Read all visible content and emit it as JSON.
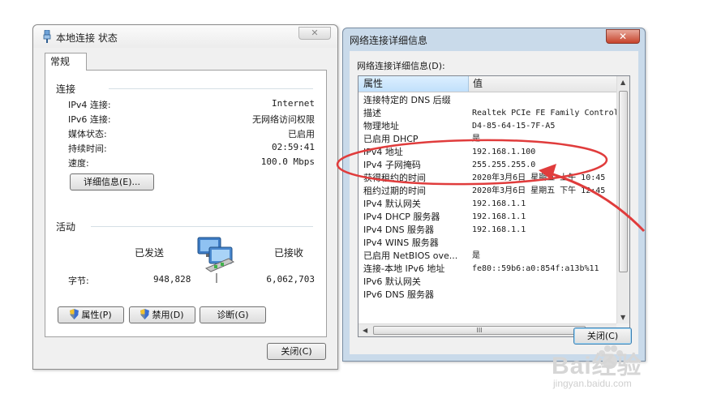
{
  "status_window": {
    "title": "本地连接 状态",
    "close_glyph": "✕",
    "tab": "常规",
    "connection": {
      "section_label": "连接",
      "rows": [
        {
          "label": "IPv4 连接:",
          "value": "Internet"
        },
        {
          "label": "IPv6 连接:",
          "value": "无网络访问权限"
        },
        {
          "label": "媒体状态:",
          "value": "已启用"
        },
        {
          "label": "持续时间:",
          "value": "02:59:41"
        },
        {
          "label": "速度:",
          "value": "100.0 Mbps"
        }
      ],
      "details_button": "详细信息(E)..."
    },
    "activity": {
      "section_label": "活动",
      "sent_label": "已发送",
      "received_label": "已接收",
      "bytes_label": "字节:",
      "bytes_sent": "948,828",
      "bytes_received": "6,062,703"
    },
    "buttons": {
      "properties": "属性(P)",
      "disable": "禁用(D)",
      "diagnose": "诊断(G)",
      "close": "关闭(C)"
    }
  },
  "details_window": {
    "title": "网络连接详细信息",
    "close_glyph": "✕",
    "list_label": "网络连接详细信息(D):",
    "columns": {
      "property": "属性",
      "value": "值"
    },
    "rows": [
      {
        "p": "连接特定的 DNS 后缀",
        "v": ""
      },
      {
        "p": "描述",
        "v": "Realtek PCIe FE Family Control"
      },
      {
        "p": "物理地址",
        "v": "D4-85-64-15-7F-A5"
      },
      {
        "p": "已启用 DHCP",
        "v": "是"
      },
      {
        "p": "IPv4 地址",
        "v": "192.168.1.100"
      },
      {
        "p": "IPv4 子网掩码",
        "v": "255.255.255.0"
      },
      {
        "p": "获得租约的时间",
        "v": "2020年3月6日 星期五 上午 10:45"
      },
      {
        "p": "租约过期的时间",
        "v": "2020年3月6日 星期五 下午 12:45"
      },
      {
        "p": "IPv4 默认网关",
        "v": "192.168.1.1"
      },
      {
        "p": "IPv4 DHCP 服务器",
        "v": "192.168.1.1"
      },
      {
        "p": "IPv4 DNS 服务器",
        "v": "192.168.1.1"
      },
      {
        "p": "IPv4 WINS 服务器",
        "v": ""
      },
      {
        "p": "已启用 NetBIOS ove...",
        "v": "是"
      },
      {
        "p": "连接-本地 IPv6 地址",
        "v": "fe80::59b6:a0:854f:a13b%11"
      },
      {
        "p": "IPv6 默认网关",
        "v": ""
      },
      {
        "p": "IPv6 DNS 服务器",
        "v": ""
      }
    ],
    "scroll_grip": "III",
    "close_button": "关闭(C)"
  },
  "annotation": {
    "color": "#e03c3c"
  },
  "watermark": {
    "line1": "Bai经验",
    "line2": "jingyan.baidu.com"
  }
}
